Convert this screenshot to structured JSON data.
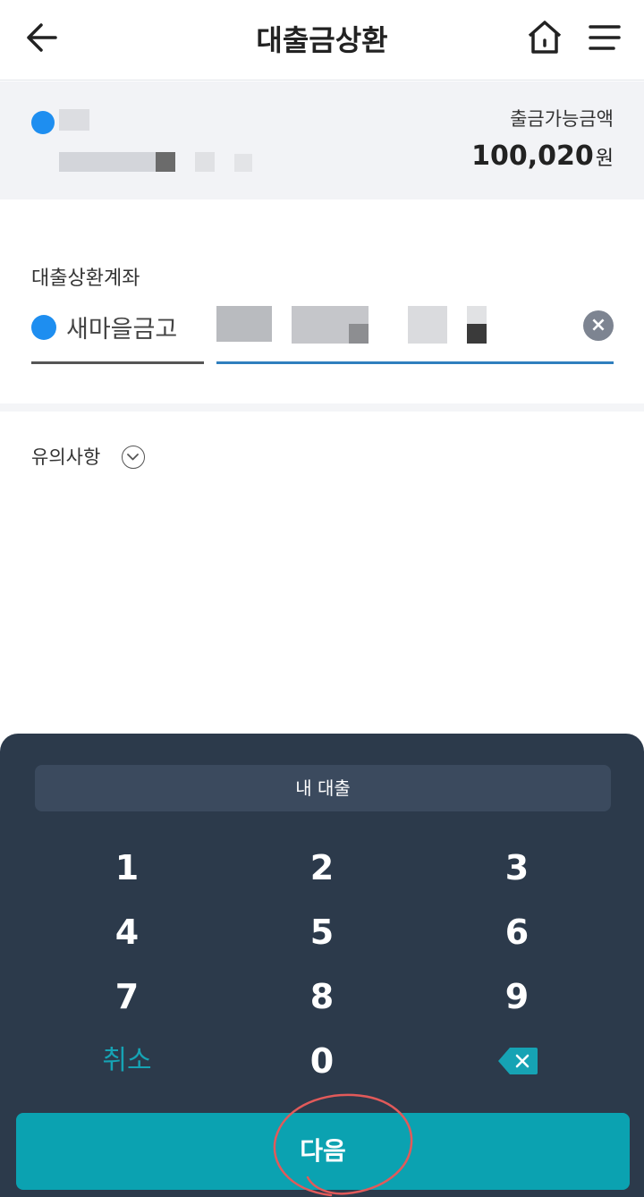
{
  "header": {
    "title": "대출금상환"
  },
  "summary": {
    "available_label": "출금가능금액",
    "available_amount": "100,020",
    "currency": "원"
  },
  "repay_account": {
    "label": "대출상환계좌",
    "bank_name": "새마을금고",
    "clear_symbol": "×"
  },
  "notice": {
    "label": "유의사항"
  },
  "keypad": {
    "title": "내 대출",
    "keys": [
      "1",
      "2",
      "3",
      "4",
      "5",
      "6",
      "7",
      "8",
      "9"
    ],
    "cancel_label": "취소",
    "zero": "0",
    "next_label": "다음"
  },
  "colors": {
    "accent": "#0ba2b1",
    "keypad_bg": "#2c3a4b",
    "bank_icon": "#1e8ef0",
    "annotation_circle": "#e25a5a"
  },
  "icons": {
    "back": "arrow-left-icon",
    "home": "home-icon",
    "menu": "hamburger-menu-icon",
    "bank": "bank-logo-icon",
    "clear": "close-circle-icon",
    "toggle": "chevron-down-icon",
    "backspace": "backspace-icon"
  }
}
